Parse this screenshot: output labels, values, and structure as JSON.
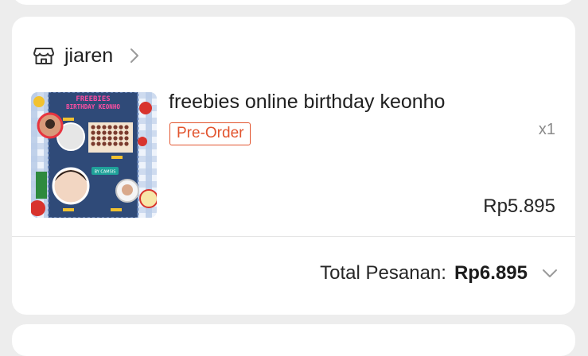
{
  "shop": {
    "name": "jiaren",
    "icon": "store-icon",
    "chevron_icon": "chevron-right-icon"
  },
  "product": {
    "title": "freebies online birthday keonho",
    "badge": "Pre-Order",
    "quantity": "x1",
    "price": "Rp5.895",
    "thumbnail": {
      "headline_line1": "FREEBIES",
      "headline_line2": "BIRTHDAY KEONHO",
      "tag": "BY CAMSIS"
    }
  },
  "order": {
    "total_label": "Total Pesanan:",
    "total_value": "Rp6.895",
    "expand_icon": "chevron-down-icon"
  },
  "colors": {
    "badge": "#e2542e",
    "thumb_bg": "#2f4a78",
    "thumb_title": "#ff4fa3"
  }
}
